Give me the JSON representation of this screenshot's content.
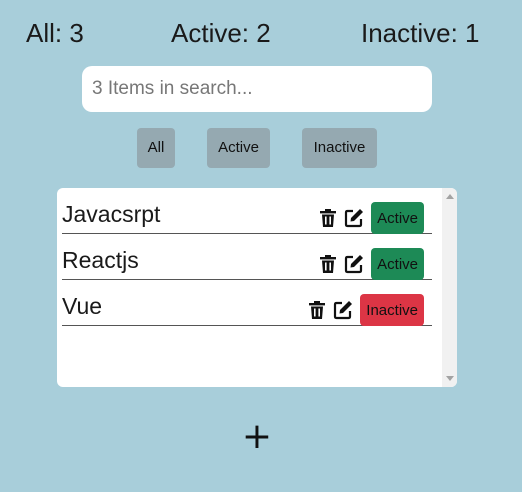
{
  "counters": {
    "all": "All: 3",
    "active": "Active: 2",
    "inactive": "Inactive: 1"
  },
  "search": {
    "placeholder": "3 Items in search...",
    "value": ""
  },
  "filters": {
    "all": "All",
    "active": "Active",
    "inactive": "Inactive"
  },
  "items": [
    {
      "name": "Javacsrpt",
      "status": "Active",
      "status_color": "#1d8a56"
    },
    {
      "name": "Reactjs",
      "status": "Active",
      "status_color": "#1d8a56"
    },
    {
      "name": "Vue",
      "status": "Inactive",
      "status_color": "#dc3545"
    }
  ],
  "icons": {
    "delete": "trash-icon",
    "edit": "edit-icon"
  },
  "add_button": "+",
  "colors": {
    "background": "#a8ceda",
    "filter_button": "#95a9b1",
    "active": "#1d8a56",
    "inactive": "#dc3545"
  }
}
